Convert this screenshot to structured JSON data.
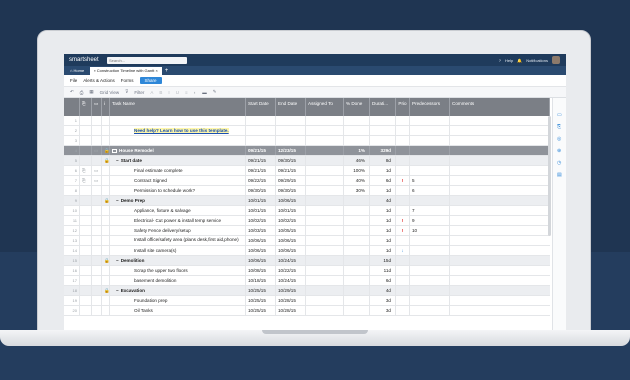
{
  "app": {
    "logo": "smartsheet",
    "search_placeholder": "Search...",
    "help": "Help",
    "notifications": "Notifications"
  },
  "tabs": [
    {
      "label": "Home"
    },
    {
      "label": "Construction Timeline with Gantt"
    }
  ],
  "menu": {
    "file": "File",
    "alerts": "Alerts & Actions",
    "forms": "Forms",
    "share": "Share"
  },
  "toolbar": {
    "grid_view": "Grid View",
    "filter": "Filter"
  },
  "columns": {
    "task_name": "Task Name",
    "start_date": "Start Date",
    "end_date": "End Date",
    "assigned_to": "Assigned To",
    "pct_done": "% Done",
    "duration": "Durati...",
    "prio": "Prio",
    "predecessors": "Predecessors",
    "comments": "Comments"
  },
  "rows": [
    {
      "n": "1",
      "task": "",
      "start": "",
      "end": "",
      "pct": "",
      "dur": "",
      "prio": "",
      "pred": ""
    },
    {
      "n": "2",
      "task": "Need help? Learn how to use this template.",
      "start": "",
      "end": "",
      "pct": "",
      "dur": "",
      "prio": "",
      "pred": ""
    },
    {
      "n": "3",
      "task": "",
      "start": "",
      "end": "",
      "pct": "",
      "dur": "",
      "prio": "",
      "pred": ""
    },
    {
      "n": "4",
      "task": "House Remodel",
      "start": "09/21/15",
      "end": "12/23/15",
      "pct": "1%",
      "dur": "329d",
      "prio": "",
      "pred": ""
    },
    {
      "n": "5",
      "task": "Start date",
      "start": "09/21/15",
      "end": "09/30/15",
      "pct": "46%",
      "dur": "8d",
      "prio": "",
      "pred": ""
    },
    {
      "n": "6",
      "task": "Final estimate complete",
      "start": "09/21/15",
      "end": "09/21/15",
      "pct": "100%",
      "dur": "1d",
      "prio": "",
      "pred": ""
    },
    {
      "n": "7",
      "task": "Contract Signed",
      "start": "09/22/15",
      "end": "09/29/15",
      "pct": "40%",
      "dur": "6d",
      "prio": "!",
      "pred": "5"
    },
    {
      "n": "8",
      "task": "Permission to schedule work?",
      "start": "09/30/15",
      "end": "09/30/15",
      "pct": "30%",
      "dur": "1d",
      "prio": "",
      "pred": "6"
    },
    {
      "n": "9",
      "task": "Demo Prep",
      "start": "10/01/15",
      "end": "10/06/15",
      "pct": "",
      "dur": "4d",
      "prio": "",
      "pred": ""
    },
    {
      "n": "10",
      "task": "Appliance, fixture & salvage",
      "start": "10/01/15",
      "end": "10/01/15",
      "pct": "",
      "dur": "1d",
      "prio": "",
      "pred": "7"
    },
    {
      "n": "11",
      "task": "Electrical- Cut power & install temp service",
      "start": "10/02/15",
      "end": "10/02/15",
      "pct": "",
      "dur": "1d",
      "prio": "!",
      "pred": "9"
    },
    {
      "n": "12",
      "task": "Safety Fence delivery/setup",
      "start": "10/03/15",
      "end": "10/05/15",
      "pct": "",
      "dur": "1d",
      "prio": "!",
      "pred": "10"
    },
    {
      "n": "13",
      "task": "Install office/safety area (plans desk,first aid,phone)",
      "start": "10/06/15",
      "end": "10/06/15",
      "pct": "",
      "dur": "1d",
      "prio": "",
      "pred": ""
    },
    {
      "n": "14",
      "task": "Install site camera(s)",
      "start": "10/06/15",
      "end": "10/06/15",
      "pct": "",
      "dur": "1d",
      "prio": "↓",
      "pred": ""
    },
    {
      "n": "15",
      "task": "Demolition",
      "start": "10/06/15",
      "end": "10/24/15",
      "pct": "",
      "dur": "15d",
      "prio": "",
      "pred": ""
    },
    {
      "n": "16",
      "task": "Scrap the upper two floors",
      "start": "10/08/15",
      "end": "10/22/15",
      "pct": "",
      "dur": "11d",
      "prio": "",
      "pred": ""
    },
    {
      "n": "17",
      "task": "basement demolition",
      "start": "10/18/15",
      "end": "10/24/15",
      "pct": "",
      "dur": "6d",
      "prio": "",
      "pred": ""
    },
    {
      "n": "18",
      "task": "Excavation",
      "start": "10/25/15",
      "end": "10/29/15",
      "pct": "",
      "dur": "4d",
      "prio": "",
      "pred": ""
    },
    {
      "n": "19",
      "task": "Foundation prep",
      "start": "10/25/15",
      "end": "10/28/15",
      "pct": "",
      "dur": "3d",
      "prio": "",
      "pred": ""
    },
    {
      "n": "20",
      "task": "Oil Tanks",
      "start": "10/25/15",
      "end": "10/28/15",
      "pct": "",
      "dur": "3d",
      "prio": "",
      "pred": ""
    }
  ]
}
